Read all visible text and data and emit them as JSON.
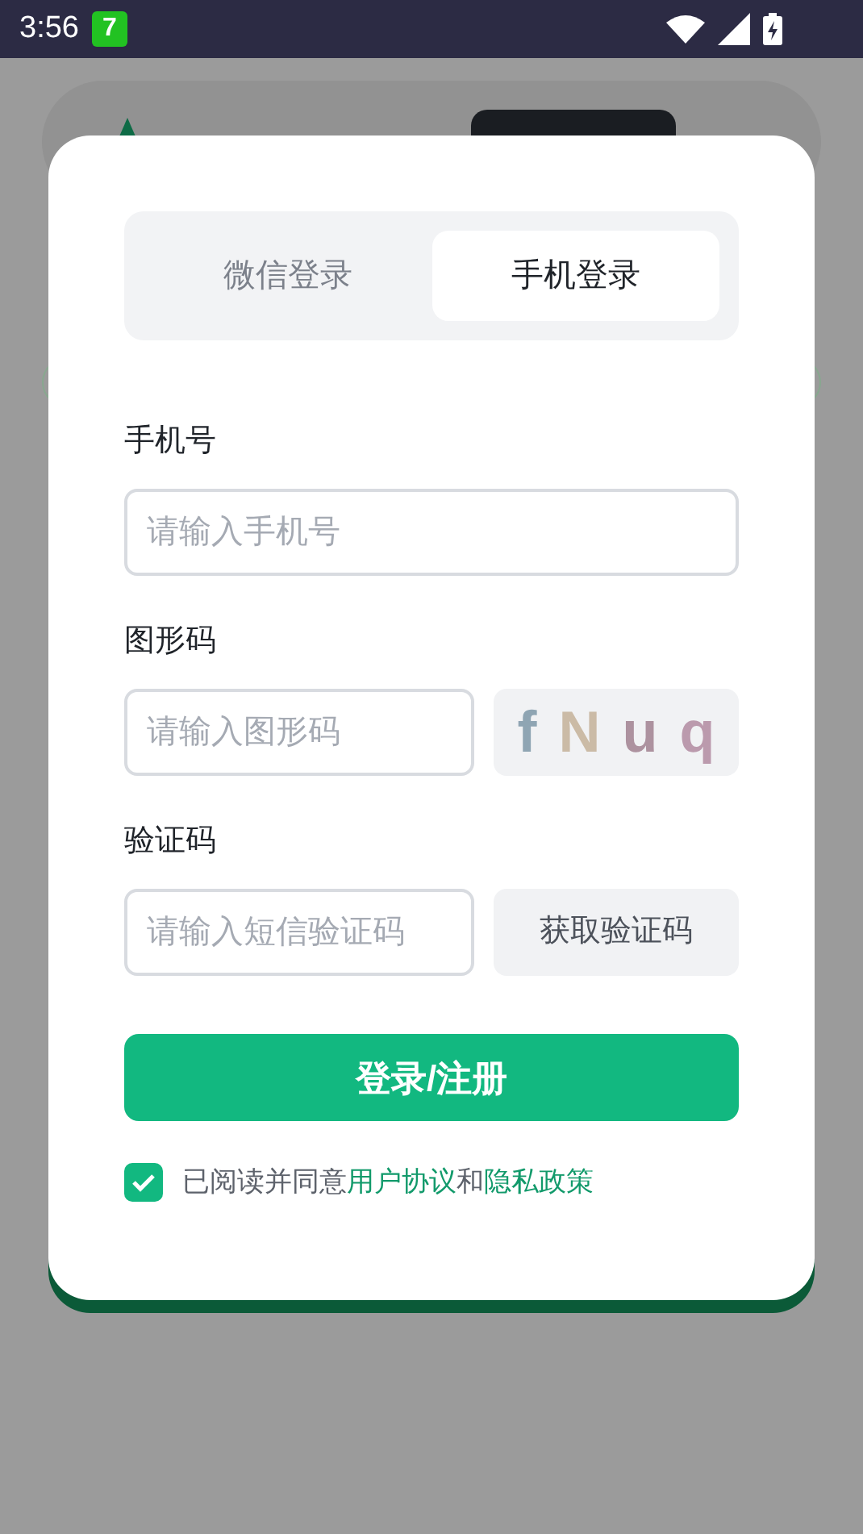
{
  "status_bar": {
    "time": "3:56",
    "app_badge": "7"
  },
  "dialog": {
    "tabs": [
      {
        "label": "微信登录",
        "selected": false
      },
      {
        "label": "手机登录",
        "selected": true
      }
    ],
    "fields": [
      {
        "kind": "plain",
        "label": "手机号",
        "placeholder": "请输入手机号"
      },
      {
        "kind": "captcha",
        "label": "图形码",
        "placeholder": "请输入图形码",
        "captcha": [
          {
            "text": "f",
            "color": "#8fa5b3"
          },
          {
            "text": "N",
            "color": "#cbbba6"
          },
          {
            "text": "u",
            "color": "#ad929f"
          },
          {
            "text": "q",
            "color": "#bb9aad"
          }
        ]
      },
      {
        "kind": "sms",
        "label": "验证码",
        "placeholder": "请输入短信验证码",
        "button": "获取验证码"
      }
    ],
    "submit": "登录/注册",
    "agreement": {
      "checked": true,
      "text": "已阅读并同意",
      "link_1": "用户协议",
      "joiner": "和",
      "link_2": "隐私政策"
    }
  }
}
